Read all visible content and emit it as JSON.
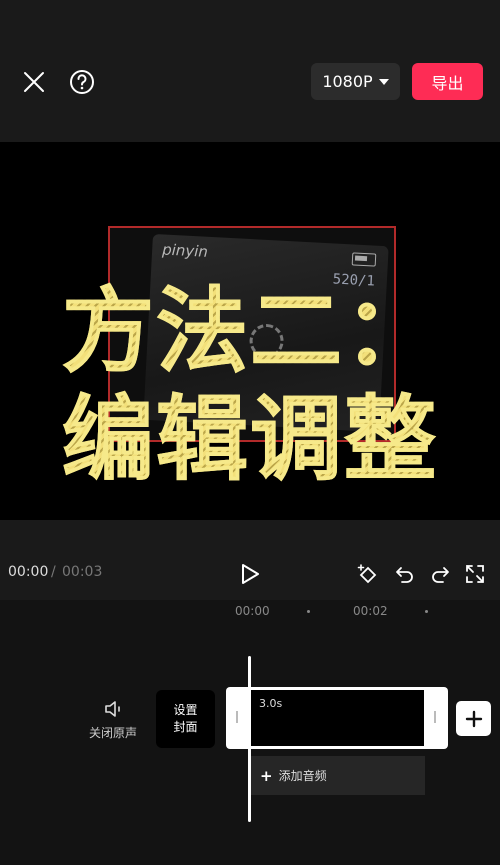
{
  "header": {
    "resolution_label": "1080P",
    "export_label": "导出",
    "colors": {
      "accent": "#fe2c55",
      "panel": "#2c2c2c"
    }
  },
  "preview": {
    "title_line1": "方法二：",
    "title_line2": "编辑调整",
    "phone_app_text": "pinyin",
    "phone_counter": "520/1",
    "title_color": "#f1e27a"
  },
  "playback": {
    "current_time": "00:00",
    "separator": "/",
    "total_time": "00:03"
  },
  "timeline": {
    "ruler_ticks": [
      "00:00",
      "00:02"
    ],
    "mute_label": "关闭原声",
    "cover_label_line1": "设置",
    "cover_label_line2": "封面",
    "clip_duration": "3.0s",
    "add_audio_label": "添加音频"
  }
}
